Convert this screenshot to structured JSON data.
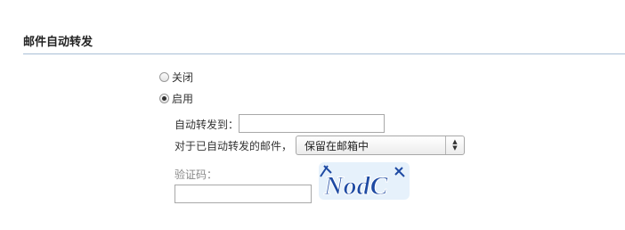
{
  "section": {
    "title": "邮件自动转发"
  },
  "forwarding": {
    "options": [
      {
        "label": "关闭",
        "checked": false
      },
      {
        "label": "启用",
        "checked": true
      }
    ],
    "forward_to_label": "自动转发到：",
    "forward_to_value": "",
    "after_forward_label": "对于已自动转发的邮件，",
    "after_forward_selected": "保留在邮箱中",
    "captcha_label": "验证码：",
    "captcha_value": "",
    "captcha_text": "NodC"
  },
  "colors": {
    "captcha_blue": "#1e4aa3",
    "captcha_bg": "#e6f1fb",
    "rule": "#a9bfd6"
  }
}
